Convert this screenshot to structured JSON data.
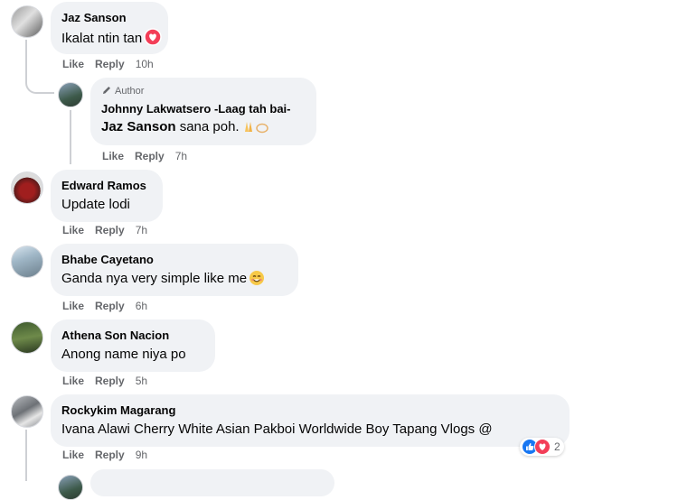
{
  "colors": {
    "bubble": "#f0f2f5",
    "meta": "#65676b",
    "like": "#1877f2",
    "love": "#f33e58"
  },
  "comments": [
    {
      "name": "Jaz Sanson",
      "text": "Ikalat ntin tan",
      "emoji": "heart-icon",
      "like": "Like",
      "reply": "Reply",
      "time": "10h"
    },
    {
      "author_badge": "Author",
      "name": "Johnny Lakwatsero -Laag tah bai-",
      "mention": "Jaz Sanson",
      "text": " sana poh.",
      "emoji": "folded-hands-icon",
      "like": "Like",
      "reply": "Reply",
      "time": "7h"
    },
    {
      "name": "Edward Ramos",
      "text": "Update lodi",
      "like": "Like",
      "reply": "Reply",
      "time": "7h"
    },
    {
      "name": "Bhabe Cayetano",
      "text": "Ganda nya very simple like me",
      "emoji": "smile-icon",
      "like": "Like",
      "reply": "Reply",
      "time": "6h"
    },
    {
      "name": "Athena Son Nacion",
      "text": "Anong name niya po",
      "like": "Like",
      "reply": "Reply",
      "time": "5h"
    },
    {
      "name": "Rockykim Magarang",
      "text": "Ivana Alawi Cherry White Asian Pakboi Worldwide Boy Tapang Vlogs @",
      "like": "Like",
      "reply": "Reply",
      "time": "9h",
      "reactions": [
        "like-icon",
        "love-icon"
      ],
      "reaction_count": "2"
    }
  ]
}
